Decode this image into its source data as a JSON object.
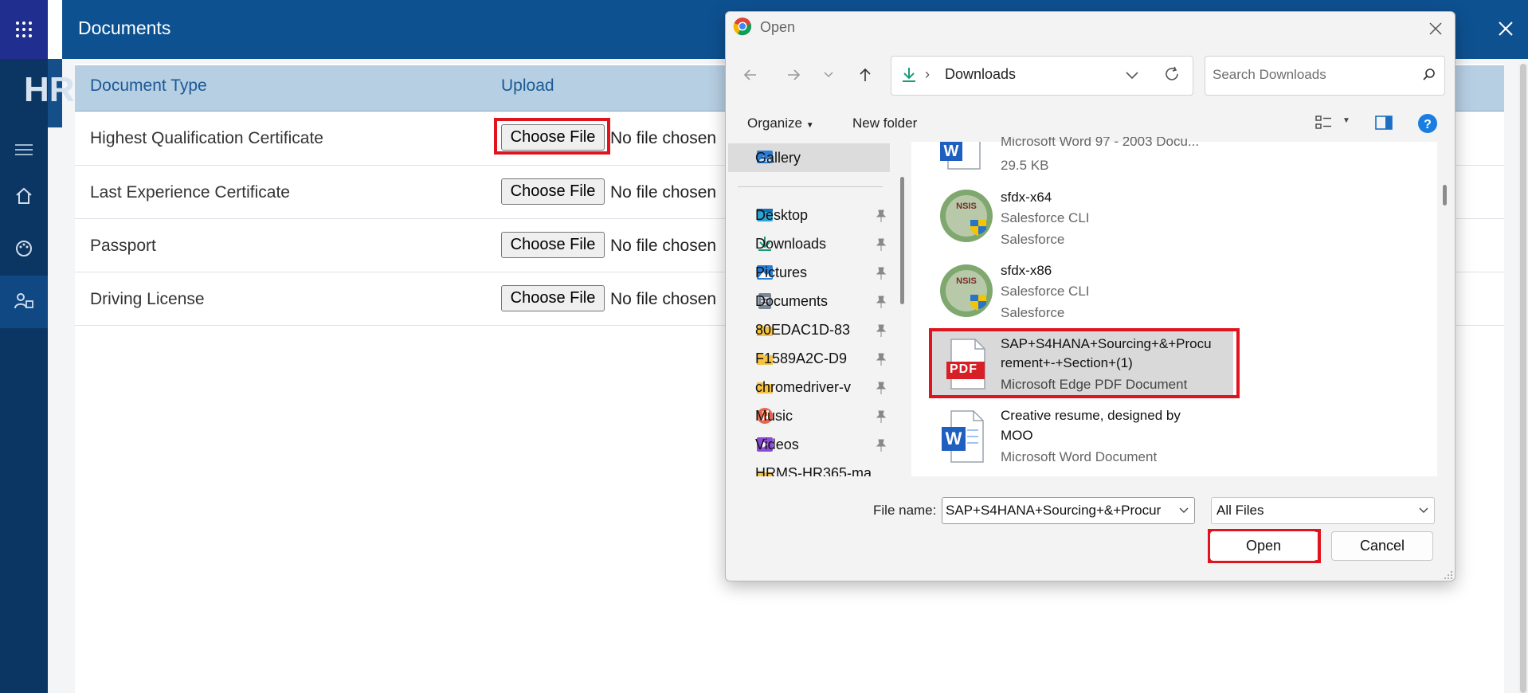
{
  "app": {
    "brand_text": "HR",
    "page_title": "Documents"
  },
  "table": {
    "headers": {
      "document_type": "Document Type",
      "upload": "Upload"
    },
    "rows": [
      {
        "label": "Highest Qualification Certificate",
        "button": "Choose File",
        "status": "No file chosen"
      },
      {
        "label": "Last Experience Certificate",
        "button": "Choose File",
        "status": "No file chosen"
      },
      {
        "label": "Passport",
        "button": "Choose File",
        "status": "No file chosen"
      },
      {
        "label": "Driving License",
        "button": "Choose File",
        "status": "No file chosen"
      }
    ]
  },
  "dialog": {
    "title": "Open",
    "address": "Downloads",
    "search_placeholder": "Search Downloads",
    "toolbar": {
      "organize": "Organize",
      "new_folder": "New folder"
    },
    "nav_items": [
      {
        "label": "Gallery",
        "icon": "gallery-icon",
        "pinned": false
      },
      {
        "label": "Desktop",
        "icon": "desktop-icon",
        "pinned": true
      },
      {
        "label": "Downloads",
        "icon": "download-icon",
        "pinned": true
      },
      {
        "label": "Pictures",
        "icon": "pictures-icon",
        "pinned": true
      },
      {
        "label": "Documents",
        "icon": "documents-icon",
        "pinned": true
      },
      {
        "label": "80EDAC1D-83",
        "icon": "folder-icon",
        "pinned": true
      },
      {
        "label": "F1589A2C-D9",
        "icon": "folder-icon",
        "pinned": true
      },
      {
        "label": "chromedriver-v",
        "icon": "folder-icon",
        "pinned": true
      },
      {
        "label": "Music",
        "icon": "music-icon",
        "pinned": true
      },
      {
        "label": "Videos",
        "icon": "videos-icon",
        "pinned": true
      },
      {
        "label": "HRMS-HR365-ma",
        "icon": "folder-icon",
        "pinned": false
      }
    ],
    "files": [
      {
        "name": "Microsoft Word 97 - 2003 Docu...",
        "line2": "29.5 KB",
        "line3": "",
        "icon": "word-doc-icon"
      },
      {
        "name": "sfdx-x64",
        "line2": "Salesforce CLI",
        "line3": "Salesforce",
        "icon": "nsis-installer-icon"
      },
      {
        "name": "sfdx-x86",
        "line2": "Salesforce CLI",
        "line3": "Salesforce",
        "icon": "nsis-installer-icon"
      },
      {
        "name": "SAP+S4HANA+Sourcing+&+Procurement+-+Section+(1)",
        "name_line1": "SAP+S4HANA+Sourcing+&+Procu",
        "name_line2": "rement+-+Section+(1)",
        "line3": "Microsoft Edge PDF Document",
        "icon": "pdf-icon",
        "pdf_text": "PDF"
      },
      {
        "name_line1": "Creative resume, designed by",
        "name_line2": "MOO",
        "line3": "Microsoft Word Document",
        "icon": "word-doc-icon"
      }
    ],
    "file_name_label": "File name:",
    "file_name_value": "SAP+S4HANA+Sourcing+&+Procur",
    "file_type": "All Files",
    "buttons": {
      "open": "Open",
      "cancel": "Cancel"
    }
  },
  "colors": {
    "header": "#0e5191",
    "rail": "#0b3663",
    "highlight": "#e0141e",
    "table_head": "#b7cfe3"
  }
}
